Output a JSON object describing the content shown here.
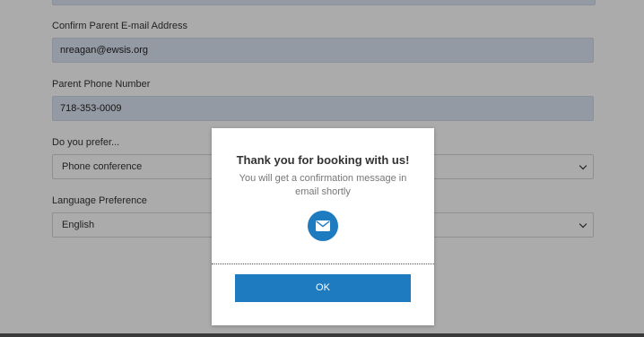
{
  "form": {
    "confirm_email": {
      "label": "Confirm Parent E-mail Address",
      "value": "nreagan@ewsis.org"
    },
    "phone": {
      "label": "Parent Phone Number",
      "value": "718-353-0009"
    },
    "preference": {
      "label": "Do you prefer...",
      "value": "Phone conference"
    },
    "language": {
      "label": "Language Preference",
      "value": "English"
    }
  },
  "modal": {
    "title": "Thank you for booking with us!",
    "message": "You will get a confirmation message in email shortly",
    "icon": "envelope-icon",
    "ok_label": "OK"
  },
  "colors": {
    "accent": "#1e7bc0",
    "input_fill": "#dde6f5",
    "overlay": "rgba(0,0,0,0.33)"
  }
}
